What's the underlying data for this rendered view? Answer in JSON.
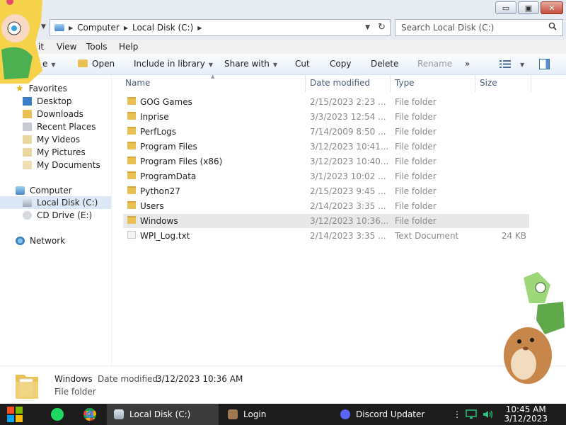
{
  "window": {
    "controls": {
      "minimize": "▭",
      "maximize": "▣",
      "close": "✕"
    }
  },
  "address": {
    "crumbs": [
      "Computer",
      "Local Disk (C:)"
    ],
    "search_placeholder": "Search Local Disk (C:)"
  },
  "menu": {
    "items": [
      "it",
      "View",
      "Tools",
      "Help"
    ]
  },
  "toolbar": {
    "organize": "e",
    "open": "Open",
    "include": "Include in library",
    "share": "Share with",
    "cut": "Cut",
    "copy": "Copy",
    "delete": "Delete",
    "rename": "Rename",
    "more": "»"
  },
  "nav": {
    "favorites_header": "Favorites",
    "favorites": [
      "Desktop",
      "Downloads",
      "Recent Places",
      "My Videos",
      "My Pictures",
      "My Documents"
    ],
    "computer_header": "Computer",
    "drives": [
      "Local Disk (C:)",
      "CD Drive (E:)"
    ],
    "network": "Network"
  },
  "columns": {
    "name": "Name",
    "date": "Date modified",
    "type": "Type",
    "size": "Size"
  },
  "files": [
    {
      "name": "GOG Games",
      "date": "2/15/2023 2:23 ...",
      "type": "File folder",
      "size": "",
      "kind": "folder"
    },
    {
      "name": "Inprise",
      "date": "3/3/2023 12:54 ...",
      "type": "File folder",
      "size": "",
      "kind": "folder"
    },
    {
      "name": "PerfLogs",
      "date": "7/14/2009 8:50 ...",
      "type": "File folder",
      "size": "",
      "kind": "folder"
    },
    {
      "name": "Program Files",
      "date": "3/12/2023 10:41...",
      "type": "File folder",
      "size": "",
      "kind": "folder"
    },
    {
      "name": "Program Files (x86)",
      "date": "3/12/2023 10:40...",
      "type": "File folder",
      "size": "",
      "kind": "folder"
    },
    {
      "name": "ProgramData",
      "date": "3/1/2023 10:02 ...",
      "type": "File folder",
      "size": "",
      "kind": "folder"
    },
    {
      "name": "Python27",
      "date": "2/15/2023 9:45 ...",
      "type": "File folder",
      "size": "",
      "kind": "folder"
    },
    {
      "name": "Users",
      "date": "2/14/2023 3:35 ...",
      "type": "File folder",
      "size": "",
      "kind": "folder"
    },
    {
      "name": "Windows",
      "date": "3/12/2023 10:36...",
      "type": "File folder",
      "size": "",
      "kind": "folder",
      "selected": true
    },
    {
      "name": "WPI_Log.txt",
      "date": "2/14/2023 3:35 ...",
      "type": "Text Document",
      "size": "24 KB",
      "kind": "text"
    }
  ],
  "details": {
    "name": "Windows",
    "date_label": "Date modified:",
    "date": "3/12/2023 10:36 AM",
    "type": "File folder"
  },
  "taskbar": {
    "tasks": [
      "Local Disk (C:)",
      "Login",
      "Discord Updater"
    ],
    "time": "10:45 AM",
    "date": "3/12/2023"
  },
  "colors": {
    "selected_row": "#e8e8e8",
    "nav_selected": "#dce8f5",
    "folder": "#e8c054",
    "taskbar": "#1c1c1c"
  }
}
